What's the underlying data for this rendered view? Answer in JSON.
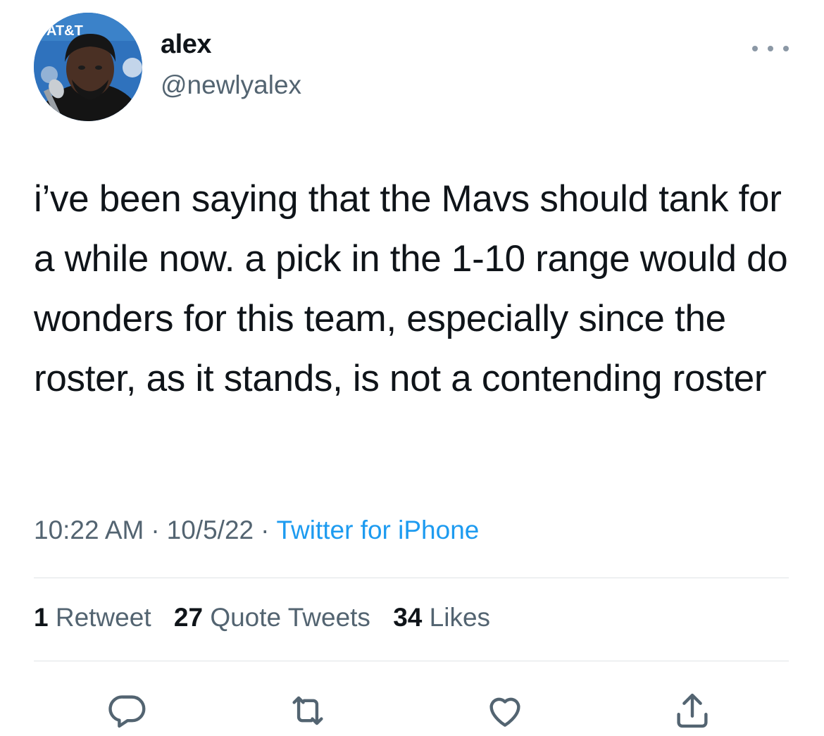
{
  "author": {
    "display_name": "alex",
    "handle": "@newlyalex",
    "avatar_label": "AT&T"
  },
  "tweet": {
    "text": "i’ve been saying that the Mavs should tank for a while now. a pick in the 1-10 range would do wonders for this team, especially since the roster, as it stands, is not a contending roster",
    "time": "10:22 AM",
    "date": "10/5/22",
    "source": "Twitter for iPhone",
    "separator": "·"
  },
  "stats": {
    "retweets_count": "1",
    "retweets_label": "Retweet",
    "quotes_count": "27",
    "quotes_label": "Quote Tweets",
    "likes_count": "34",
    "likes_label": "Likes"
  },
  "actions": {
    "reply_icon": "reply-icon",
    "retweet_icon": "retweet-icon",
    "like_icon": "heart-icon",
    "share_icon": "share-icon"
  },
  "colors": {
    "text": "#0f1419",
    "secondary": "#536471",
    "link": "#1d9bf0",
    "divider": "#dfe3e6"
  }
}
